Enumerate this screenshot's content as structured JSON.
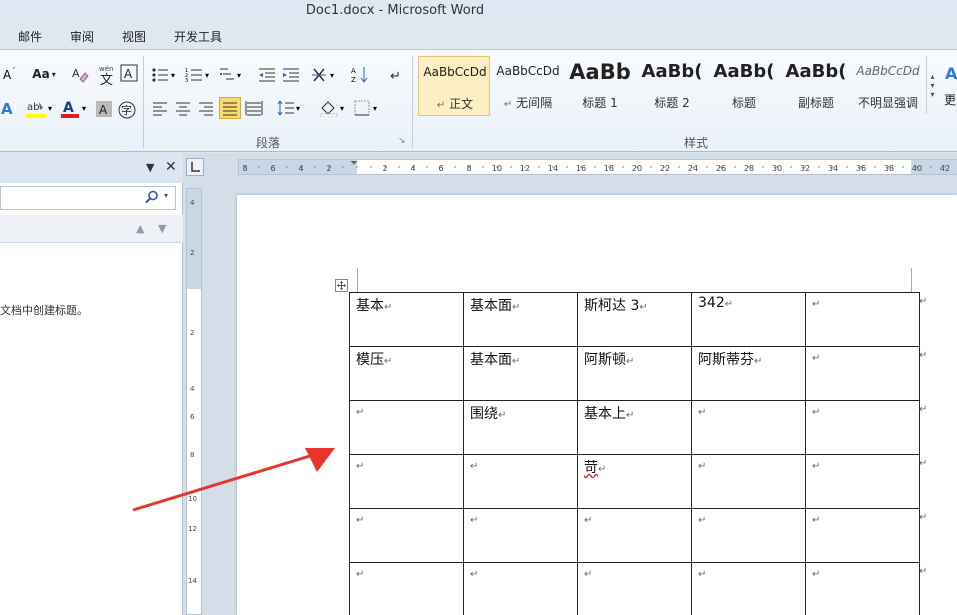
{
  "window": {
    "title": "Doc1.docx  -  Microsoft Word"
  },
  "tabs": [
    "邮件",
    "审阅",
    "视图",
    "开发工具"
  ],
  "ribbon": {
    "font_case_label": "Aa",
    "paragraph_group_label": "段落",
    "styles_group_label": "样式",
    "styles": [
      {
        "preview": "AaBbCcDd",
        "name": "正文",
        "selected": true
      },
      {
        "preview": "AaBbCcDd",
        "name": "无间隔",
        "selected": false
      },
      {
        "preview": "AaBb",
        "name": "标题 1",
        "selected": false
      },
      {
        "preview": "AaBb(",
        "name": "标题 2",
        "selected": false
      },
      {
        "preview": "AaBb(",
        "name": "标题",
        "selected": false
      },
      {
        "preview": "AaBb(",
        "name": "副标题",
        "selected": false
      },
      {
        "preview": "AaBbCcDd",
        "name": "不明显强调",
        "selected": false
      }
    ],
    "more_label": "更"
  },
  "nav_pane": {
    "message_fragment": "文档中创建标题。"
  },
  "ruler": {
    "left_ticks": [
      "8",
      "6",
      "4",
      "2"
    ],
    "ticks": [
      "2",
      "4",
      "6",
      "8",
      "10",
      "12",
      "14",
      "16",
      "18",
      "20",
      "22",
      "24",
      "26",
      "28",
      "30",
      "32",
      "34",
      "36",
      "38",
      "40",
      "42"
    ],
    "v_ticks": [
      "4",
      "2",
      "2",
      "4",
      "6",
      "8",
      "10",
      "12",
      "14"
    ]
  },
  "table": {
    "paragraph_mark": "↵",
    "rows": [
      [
        "基本",
        "基本面",
        "斯柯达 3",
        "342",
        ""
      ],
      [
        "模压",
        "基本面",
        "阿斯顿",
        "阿斯蒂芬",
        ""
      ],
      [
        "",
        "围绕",
        "基本上",
        "",
        ""
      ],
      [
        "",
        "",
        "苛",
        "",
        ""
      ],
      [
        "",
        "",
        "",
        "",
        ""
      ],
      [
        "",
        "",
        "",
        "",
        ""
      ]
    ]
  },
  "colors": {
    "accent": "#e23a2f",
    "ribbon_bg": "#e9f0f8",
    "page": "#ffffff",
    "arrow": "#e8352c"
  }
}
